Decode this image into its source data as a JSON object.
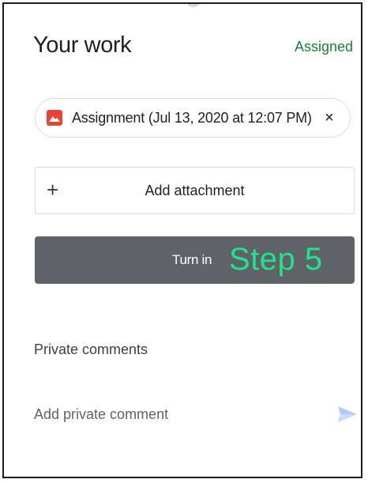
{
  "header": {
    "title": "Your work",
    "status": "Assigned"
  },
  "attachment_chip": {
    "label": "Assignment (Jul 13, 2020 at 12:07 PM)",
    "icon": "image-icon",
    "remove_glyph": "×"
  },
  "add_attachment": {
    "icon_glyph": "+",
    "label": "Add attachment"
  },
  "turn_in": {
    "label": "Turn in",
    "overlay_annotation": "Step 5"
  },
  "private_comments": {
    "section_label": "Private comments",
    "placeholder": "Add private comment",
    "value": ""
  },
  "colors": {
    "status_green": "#188038",
    "turn_in_bg": "#5f6368",
    "image_icon_red": "#ea4335",
    "annotation_green": "#21e38c",
    "send_icon_blue": "#aecbfa"
  }
}
